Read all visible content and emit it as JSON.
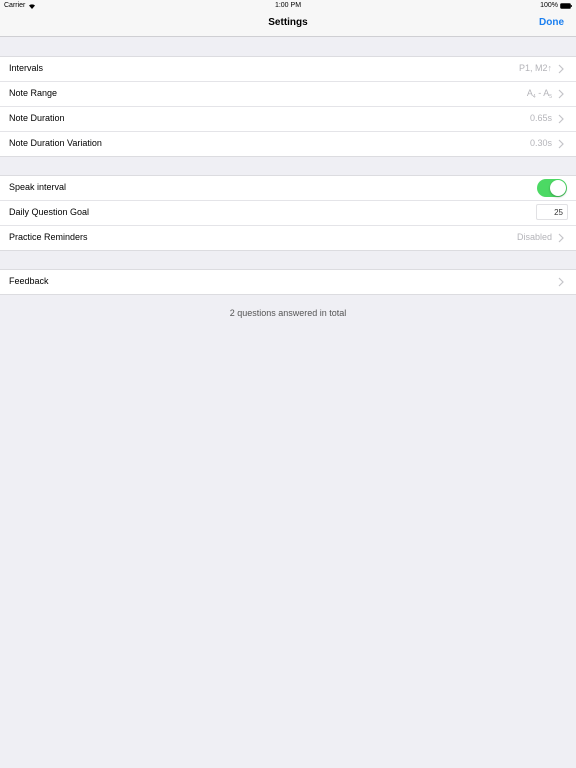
{
  "status_bar": {
    "carrier": "Carrier",
    "time": "1:00 PM",
    "battery": "100%"
  },
  "nav": {
    "title": "Settings",
    "done_label": "Done"
  },
  "group1": {
    "rows": [
      {
        "label": "Intervals",
        "value": "P1,  M2↑"
      },
      {
        "label": "Note Range",
        "value_main1": "A",
        "value_sub1": "4",
        "value_sep": " - ",
        "value_main2": "A",
        "value_sub2": "5"
      },
      {
        "label": "Note Duration",
        "value": "0.65s"
      },
      {
        "label": "Note Duration Variation",
        "value": "0.30s"
      }
    ]
  },
  "group2": {
    "speak_interval": {
      "label": "Speak interval",
      "enabled": true
    },
    "daily_goal": {
      "label": "Daily Question Goal",
      "value": "25"
    },
    "reminders": {
      "label": "Practice Reminders",
      "value": "Disabled"
    }
  },
  "group3": {
    "feedback": {
      "label": "Feedback"
    }
  },
  "footer": {
    "note": "2 questions answered in total"
  },
  "colors": {
    "accent": "#1a7ff0",
    "toggle_on": "#4cd964",
    "background": "#efeff4"
  }
}
